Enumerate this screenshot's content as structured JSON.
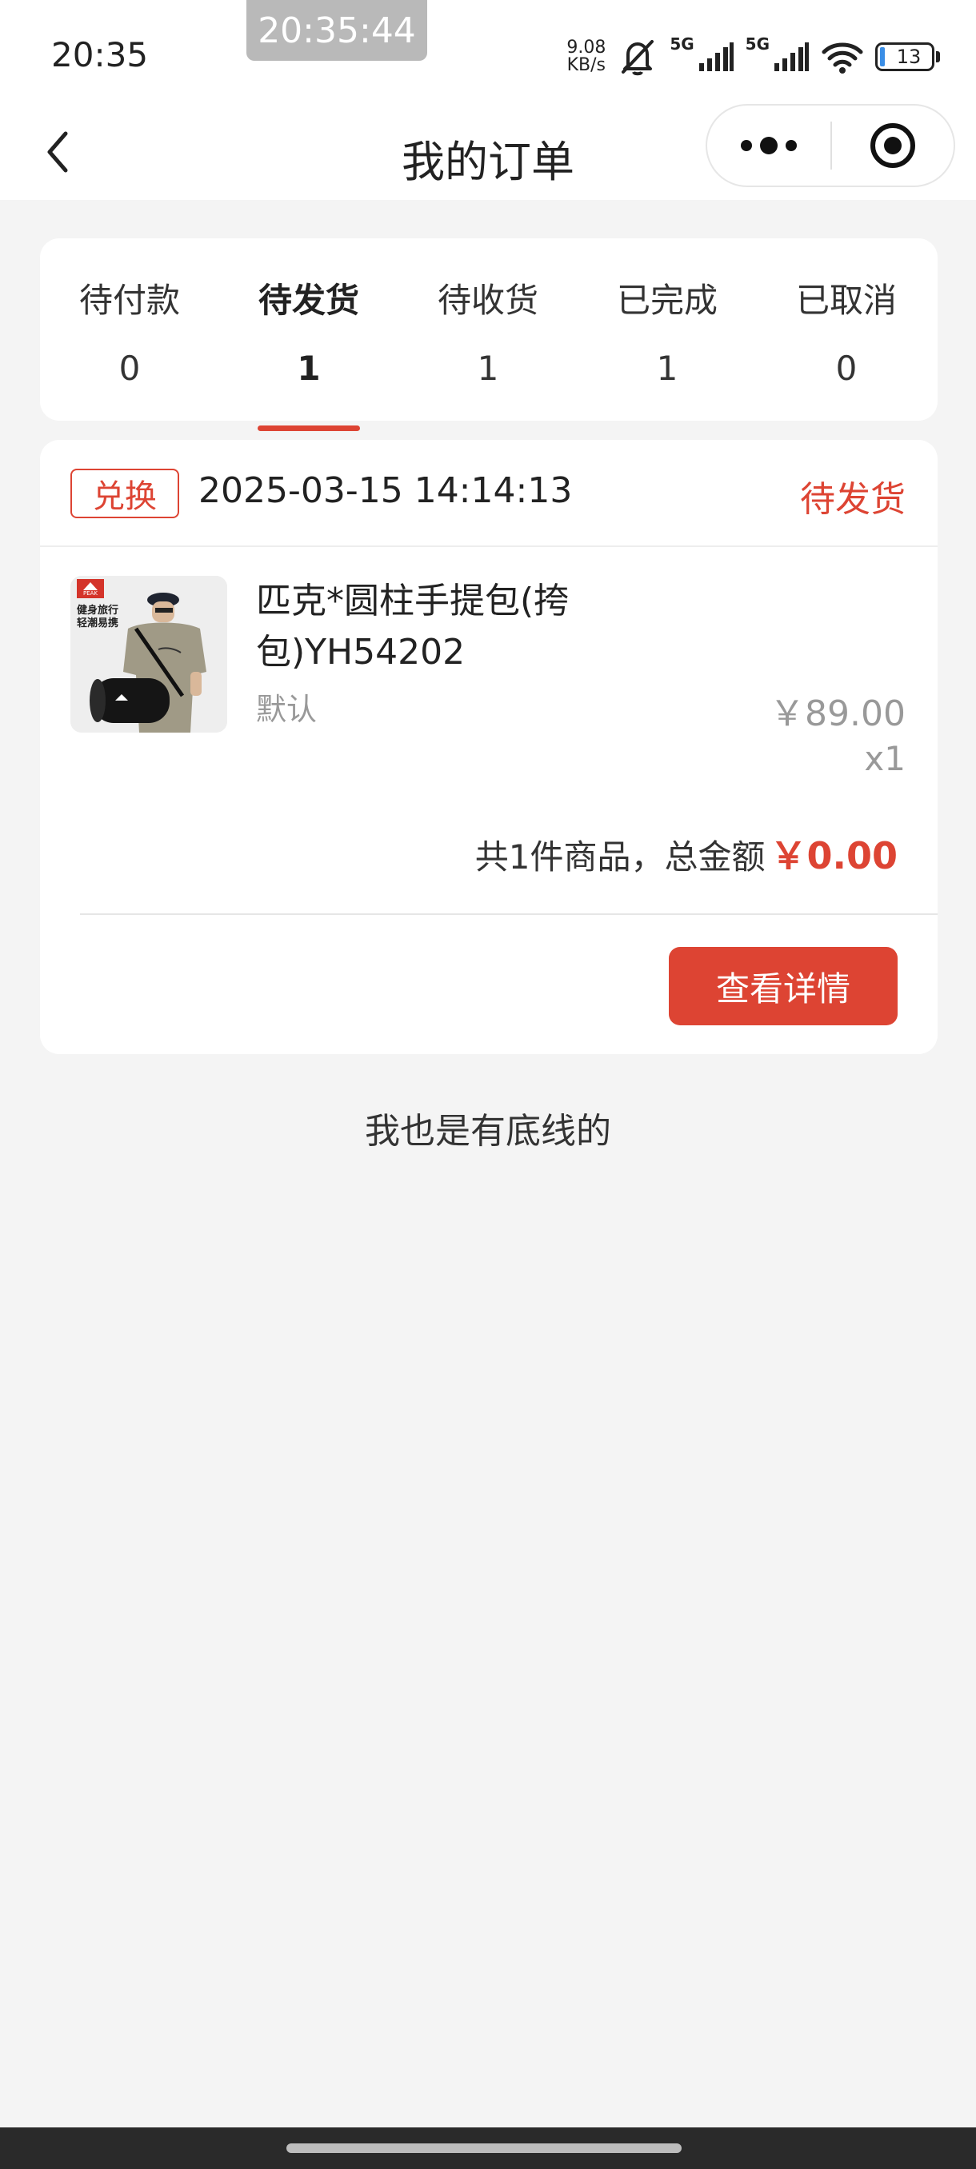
{
  "status_bar": {
    "time": "20:35",
    "floating_clock": "20:35:44",
    "net_speed_value": "9.08",
    "net_speed_unit": "KB/s",
    "signal_1_label": "5G",
    "signal_2_label": "5G",
    "battery": "13"
  },
  "title_bar": {
    "title": "我的订单"
  },
  "tabs": [
    {
      "label": "待付款",
      "count": "0"
    },
    {
      "label": "待发货",
      "count": "1",
      "active": true
    },
    {
      "label": "待收货",
      "count": "1"
    },
    {
      "label": "已完成",
      "count": "1"
    },
    {
      "label": "已取消",
      "count": "0"
    }
  ],
  "order": {
    "tag": "兑换",
    "time": "2025-03-15 14:14:13",
    "status": "待发货",
    "product": {
      "name": "匹克*圆柱手提包(挎包)YH54202",
      "spec": "默认",
      "price": "￥89.00",
      "qty": "x1",
      "thumb_brand": "PEAK",
      "thumb_caption_1": "健身旅行",
      "thumb_caption_2": "轻潮易携"
    },
    "total_text": "共1件商品，总金额",
    "total_amount": "￥0.00",
    "detail_button": "查看详情"
  },
  "footer_text": "我也是有底线的",
  "colors": {
    "accent": "#dd4433",
    "background": "#f4f4f4",
    "card": "#ffffff"
  }
}
